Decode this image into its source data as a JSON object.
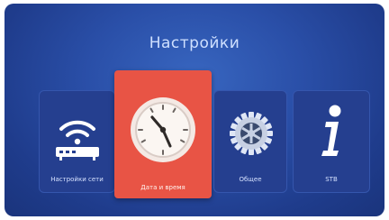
{
  "page": {
    "title": "Настройки"
  },
  "tiles": [
    {
      "id": "network",
      "label": "Настройки сети",
      "icon": "router-wifi-icon"
    },
    {
      "id": "time",
      "label": "Дата и время",
      "icon": "clock-icon",
      "selected": true
    },
    {
      "id": "general",
      "label": "Общее",
      "icon": "gear-icon"
    },
    {
      "id": "system",
      "label": "STB",
      "icon": "info-icon"
    }
  ],
  "colors": {
    "background": "#2a4fa8",
    "tile": "#253f8f",
    "selected_tile": "#e85445",
    "text": "#d6e2ff"
  }
}
